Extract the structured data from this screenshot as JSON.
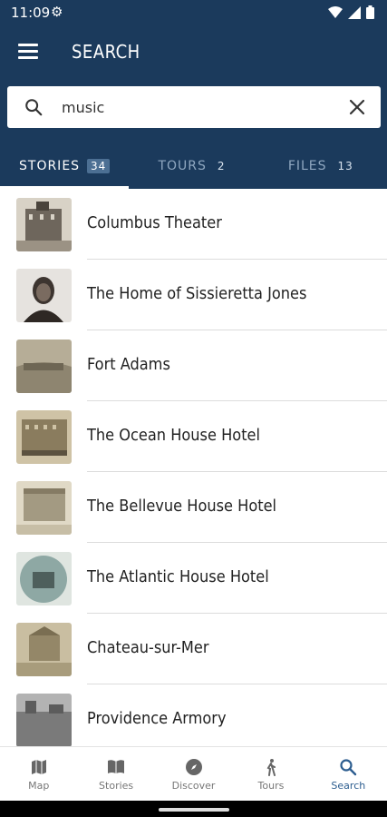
{
  "status_bar": {
    "time": "11:09"
  },
  "header": {
    "title": "SEARCH"
  },
  "search": {
    "value": "music"
  },
  "tabs": [
    {
      "label": "STORIES",
      "count": "34",
      "active": true
    },
    {
      "label": "TOURS",
      "count": "2",
      "active": false
    },
    {
      "label": "FILES",
      "count": "13",
      "active": false
    }
  ],
  "results": [
    {
      "title": "Columbus Theater"
    },
    {
      "title": "The Home of Sissieretta Jones"
    },
    {
      "title": "Fort Adams"
    },
    {
      "title": "The Ocean House Hotel"
    },
    {
      "title": "The Bellevue House Hotel"
    },
    {
      "title": "The Atlantic House Hotel"
    },
    {
      "title": "Chateau-sur-Mer"
    },
    {
      "title": "Providence Armory"
    }
  ],
  "bottom_nav": [
    {
      "label": "Map",
      "icon": "map-icon",
      "active": false
    },
    {
      "label": "Stories",
      "icon": "book-icon",
      "active": false
    },
    {
      "label": "Discover",
      "icon": "compass-icon",
      "active": false
    },
    {
      "label": "Tours",
      "icon": "walking-icon",
      "active": false
    },
    {
      "label": "Search",
      "icon": "search-icon",
      "active": true
    }
  ],
  "colors": {
    "primary": "#1b3a5c",
    "accent": "#2c5d8f",
    "badge": "#4c6f93"
  }
}
